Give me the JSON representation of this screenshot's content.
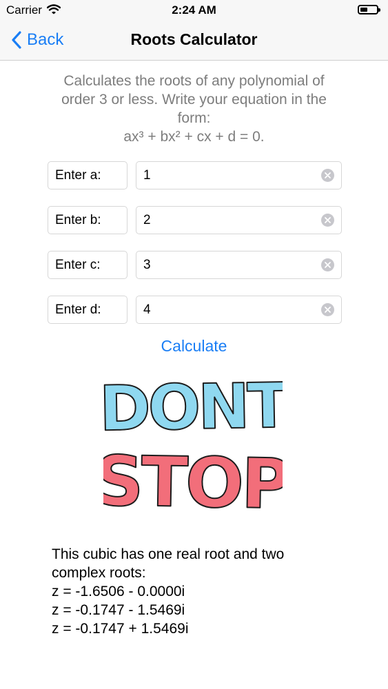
{
  "status_bar": {
    "carrier": "Carrier",
    "time": "2:24 AM"
  },
  "nav": {
    "back_label": "Back",
    "title": "Roots Calculator"
  },
  "description": {
    "lines": [
      "Calculates the roots of any polynomial of",
      "order 3 or less. Write your equation in the",
      "form:"
    ],
    "formula": "ax³ + bx² + cx + d = 0."
  },
  "inputs": [
    {
      "label": "Enter a:",
      "value": "1"
    },
    {
      "label": "Enter b:",
      "value": "2"
    },
    {
      "label": "Enter c:",
      "value": "3"
    },
    {
      "label": "Enter d:",
      "value": "4"
    }
  ],
  "calculate_label": "Calculate",
  "image": {
    "line1": "DONT",
    "line2": "STOP",
    "color_top": "#8fd8f0",
    "color_bottom": "#f26e7a"
  },
  "result": {
    "lines": [
      "This cubic has one real root and two",
      "complex roots:",
      "z = -1.6506 - 0.0000i",
      "z = -0.1747 - 1.5469i",
      "z = -0.1747 + 1.5469i"
    ]
  },
  "colors": {
    "accent": "#1a7ef5",
    "description_text": "#7d7d7d",
    "bar_background": "#f7f7f7"
  }
}
